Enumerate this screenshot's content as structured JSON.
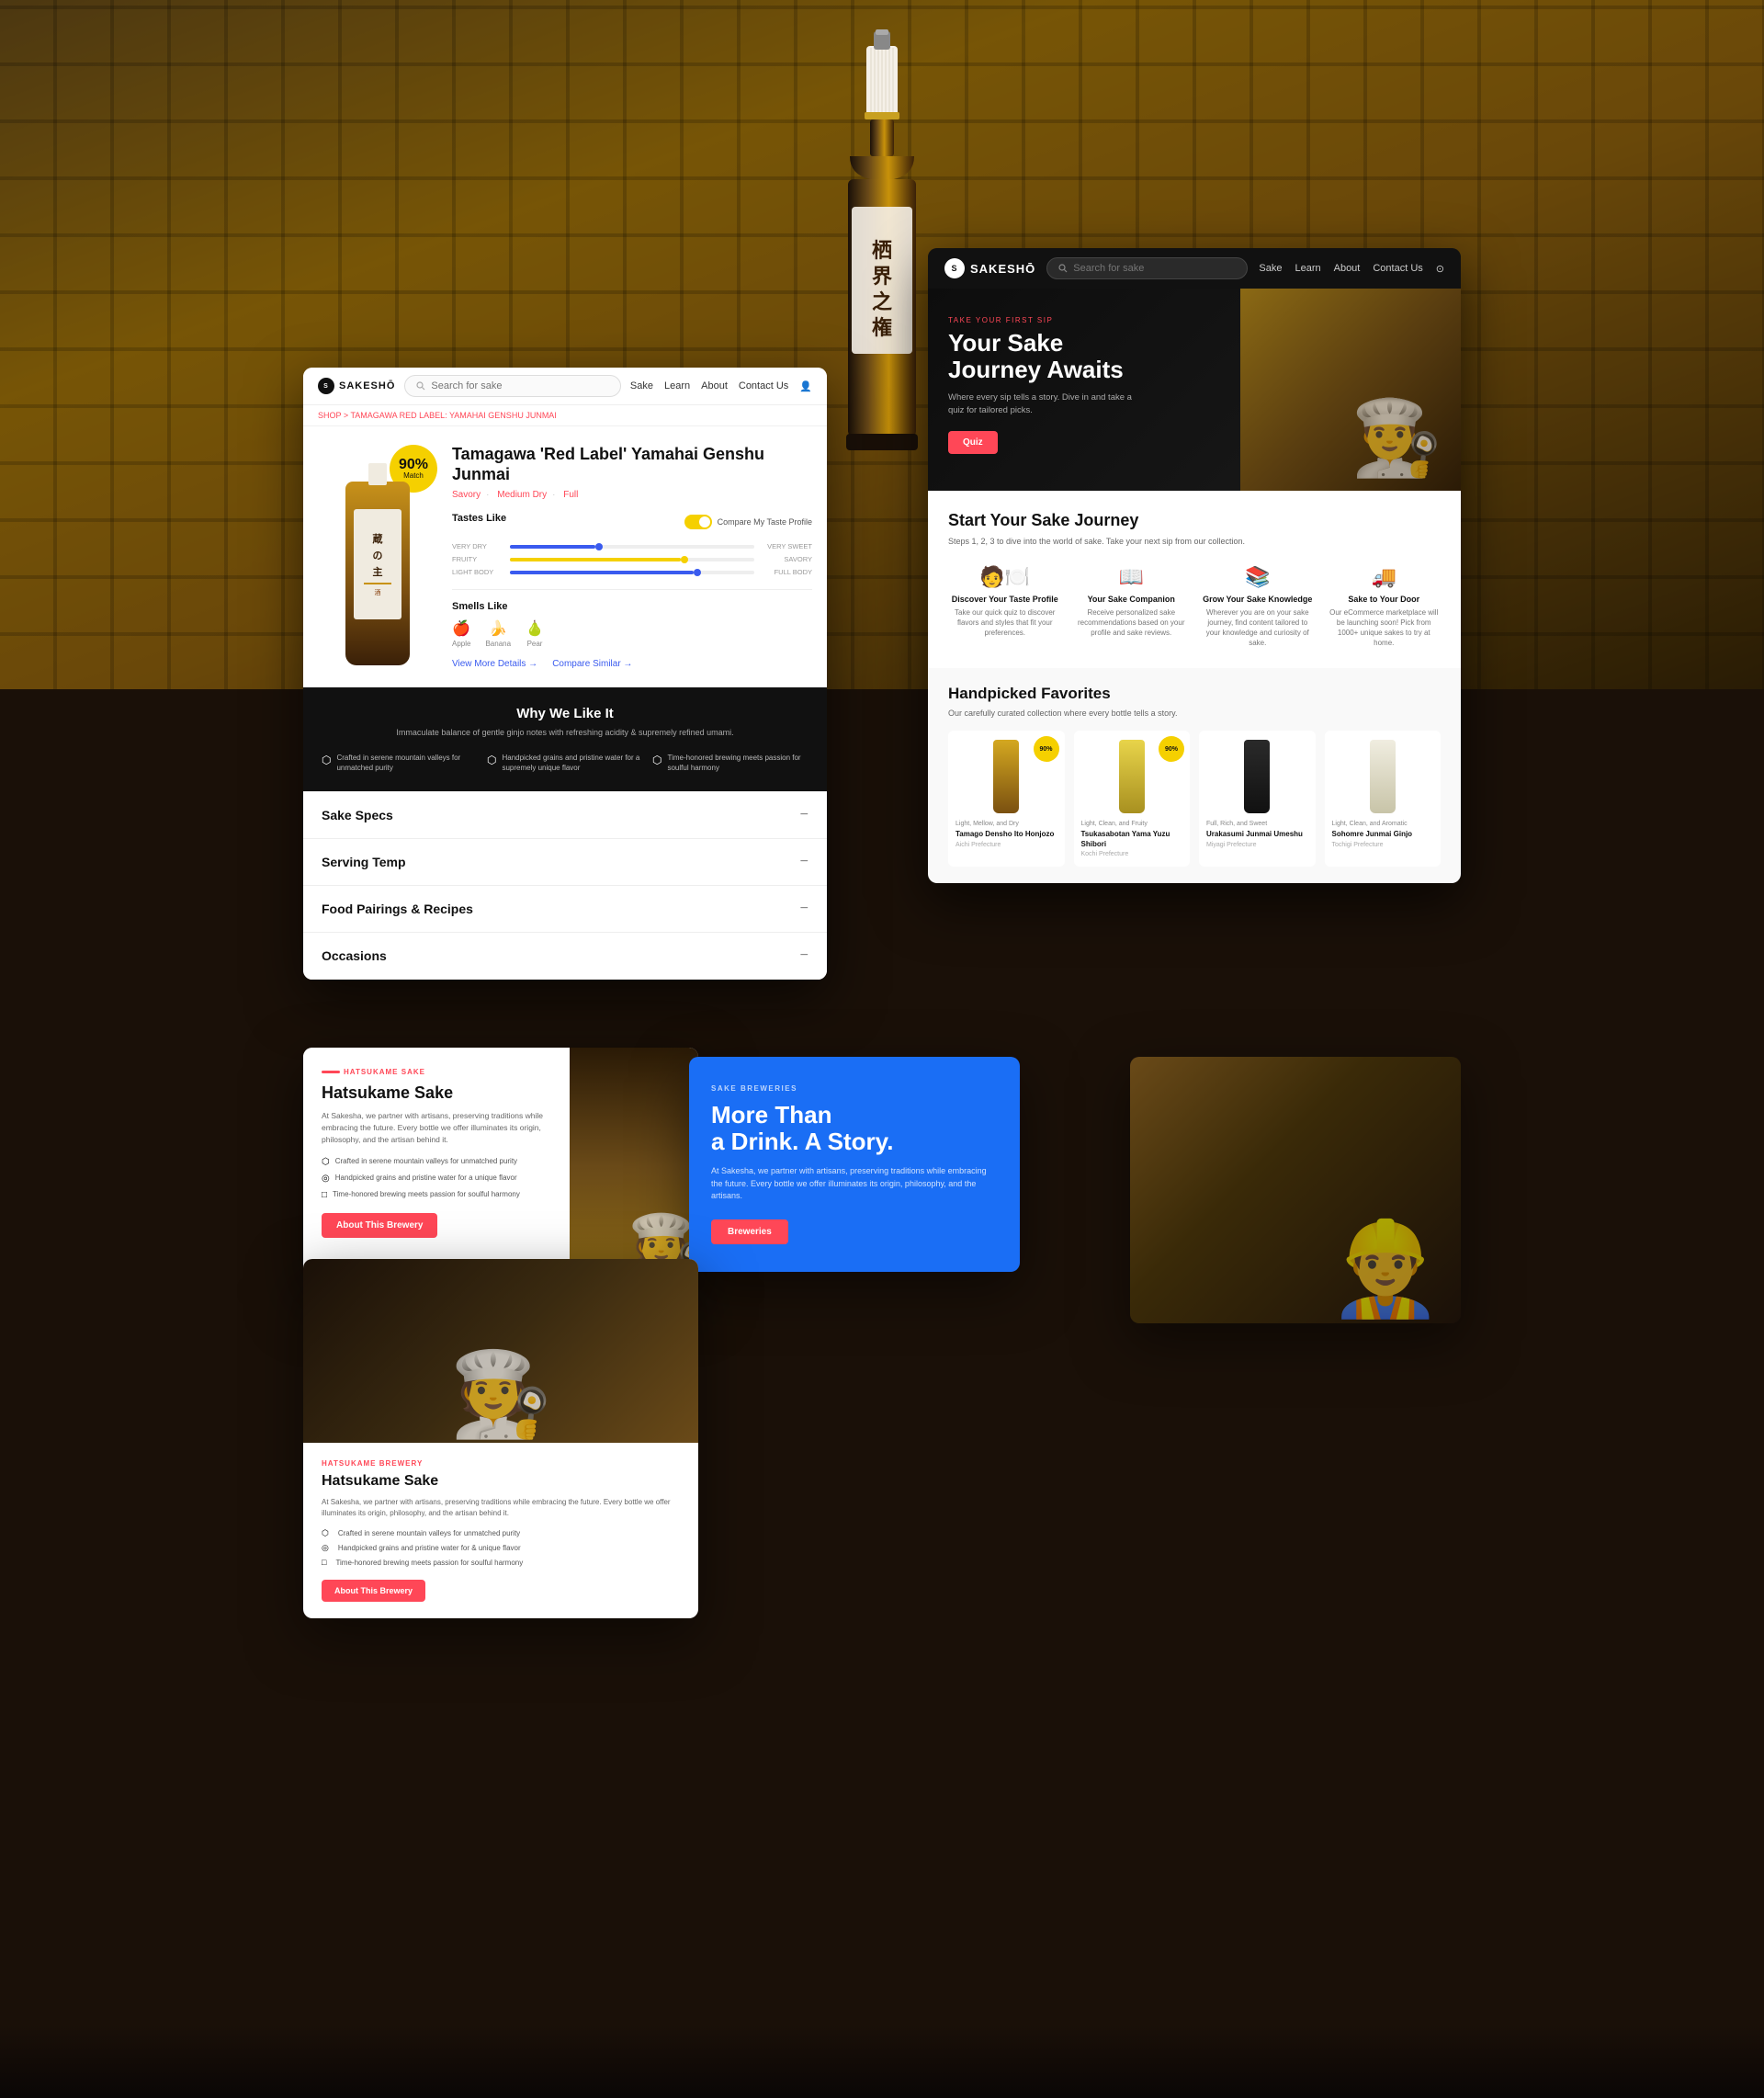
{
  "hero": {
    "bg_alt": "Sake bottle in crates background"
  },
  "homepage_panel": {
    "logo": "SAKESHŌ",
    "nav": {
      "search_placeholder": "Search for sake",
      "links": [
        "Sake",
        "Learn",
        "About",
        "Contact Us"
      ]
    },
    "hero": {
      "overline": "TAKE YOUR FIRST SIP",
      "title": "Your Sake\nJourney Awaits",
      "subtitle": "Where every sip tells a story. Dive in and take a quiz for tailored picks.",
      "cta_label": "Quiz"
    },
    "journey": {
      "title": "Start Your Sake Journey",
      "subtitle": "Steps 1, 2, 3 to dive into the world of sake. Take your next sip from our collection.",
      "steps": [
        {
          "icon": "🧑‍🍽️",
          "title": "Discover Your Taste Profile",
          "desc": "Take our quick quiz to discover flavors and styles that fit your preferences."
        },
        {
          "icon": "📖",
          "title": "Your Sake Companion",
          "desc": "Receive personalized sake recommendations based on your profile and sake reviews."
        },
        {
          "icon": "📚",
          "title": "Grow Your Sake Knowledge",
          "desc": "Wherever you are on your sake journey, find content tailored to your knowledge and curiosity of sake."
        },
        {
          "icon": "🚚",
          "title": "Sake to Your Door",
          "desc": "Our eCommerce marketplace will be launching soon! Pick from 1000+ unique sakes to try at home."
        }
      ]
    },
    "favorites": {
      "title": "Handpicked Favorites",
      "subtitle": "Our carefully curated collection where every bottle tells a story.",
      "items": [
        {
          "match": "90%",
          "tag": "Light, Mellow, and Dry",
          "name": "Tamago Densho Ito Honjozo",
          "region": "Aichi Prefecture"
        },
        {
          "match": "90%",
          "tag": "Light, Clean, and Fruity",
          "name": "Tsukasabotan Yama Yuzu Shibori",
          "region": "Kochi Prefecture"
        },
        {
          "tag": "Full, Rich, and Sweet",
          "name": "Urakasumi Junmai Umeshu",
          "region": "Miyagi Prefecture"
        },
        {
          "tag": "Light, Clean, and Aromatic",
          "name": "Sohomre Junmai Ginjo",
          "region": "Tochigi Prefecture"
        }
      ]
    }
  },
  "product_panel": {
    "logo": "SAKESHŌ",
    "nav": {
      "search_placeholder": "Search for sake",
      "links": [
        "Sake",
        "Learn",
        "About",
        "Contact Us"
      ]
    },
    "breadcrumb": "SHOP > TAMAGAWA RED LABEL: YAMAHAI GENSHU JUNMAI",
    "match": "90%\nMatch",
    "title": "Tamagawa 'Red Label' Yamahai Genshu Junmai",
    "tags": [
      "Savory",
      "Medium Dry",
      "Full"
    ],
    "tastes_like": {
      "label": "Tastes Like",
      "toggle_label": "Compare My Taste Profile",
      "bars": [
        {
          "left": "VERY DRY",
          "right": "VERY SWEET",
          "pos": 35,
          "color": "blue"
        },
        {
          "left": "FRUITY",
          "right": "SAVORY",
          "pos": 70,
          "color": "yellow"
        },
        {
          "left": "LIGHT BODY",
          "right": "FULL BODY",
          "pos": 75,
          "color": "blue"
        }
      ]
    },
    "smells_like": {
      "label": "Smells Like",
      "items": [
        "Apple",
        "Banana",
        "Pear"
      ]
    },
    "links": {
      "details": "View More Details →",
      "compare": "Compare Similar →"
    },
    "why_section": {
      "title": "Why We Like It",
      "subtitle": "Immaculate balance of gentle ginjo notes with refreshing acidity &\nsupremely refined umami.",
      "points": [
        {
          "icon": "⬡",
          "text": "Crafted in serene mountain valleys for unmatched purity"
        },
        {
          "icon": "⬡",
          "text": "Handpicked grains and pristine water for a supremely unique flavor"
        },
        {
          "icon": "⬡",
          "text": "Time-honored brewing meets passion for soulful harmony"
        }
      ]
    },
    "accordion": [
      {
        "label": "Sake Specs"
      },
      {
        "label": "Serving Temp"
      },
      {
        "label": "Food Pairings & Recipes"
      },
      {
        "label": "Occasions"
      }
    ]
  },
  "brewery_panel": {
    "overline": "HATSUKAME SAKE",
    "title": "Hatsukame Sake",
    "desc": "At Sakesha, we partner with artisans, preserving traditions while embracing the future. Every bottle we offer illuminates its origin, philosophy, and the artisan behind it.",
    "points": [
      "Crafted in serene mountain valleys for unmatched purity",
      "Handpicked grains and pristine water for a unique flavor",
      "Time-honored brewing meets passion for soulful harmony"
    ],
    "cta_label": "About This Brewery"
  },
  "blue_panel": {
    "overline": "SAKE BREWERIES",
    "title": "More Than a Drink. A Story.",
    "desc": "At Sakesha, we partner with artisans, preserving traditions while embracing the future. Every bottle we offer illuminates its origin, philosophy, and the artisans.",
    "cta_label": "Breweries"
  },
  "brewery_lower": {
    "overline": "HATSUKAME BREWERY",
    "title": "Hatsukame Sake",
    "desc": "At Sakesha, we partner with artisans, preserving traditions while embracing the future. Every bottle we offer illuminates its origin, philosophy, and the artisan behind it.",
    "points": [
      "Crafted in serene mountain valleys for unmatched purity",
      "Handpicked grains and pristine water for & unique flavor",
      "Time-honored brewing meets passion for soulful harmony"
    ],
    "cta_label": "About This Brewery"
  }
}
